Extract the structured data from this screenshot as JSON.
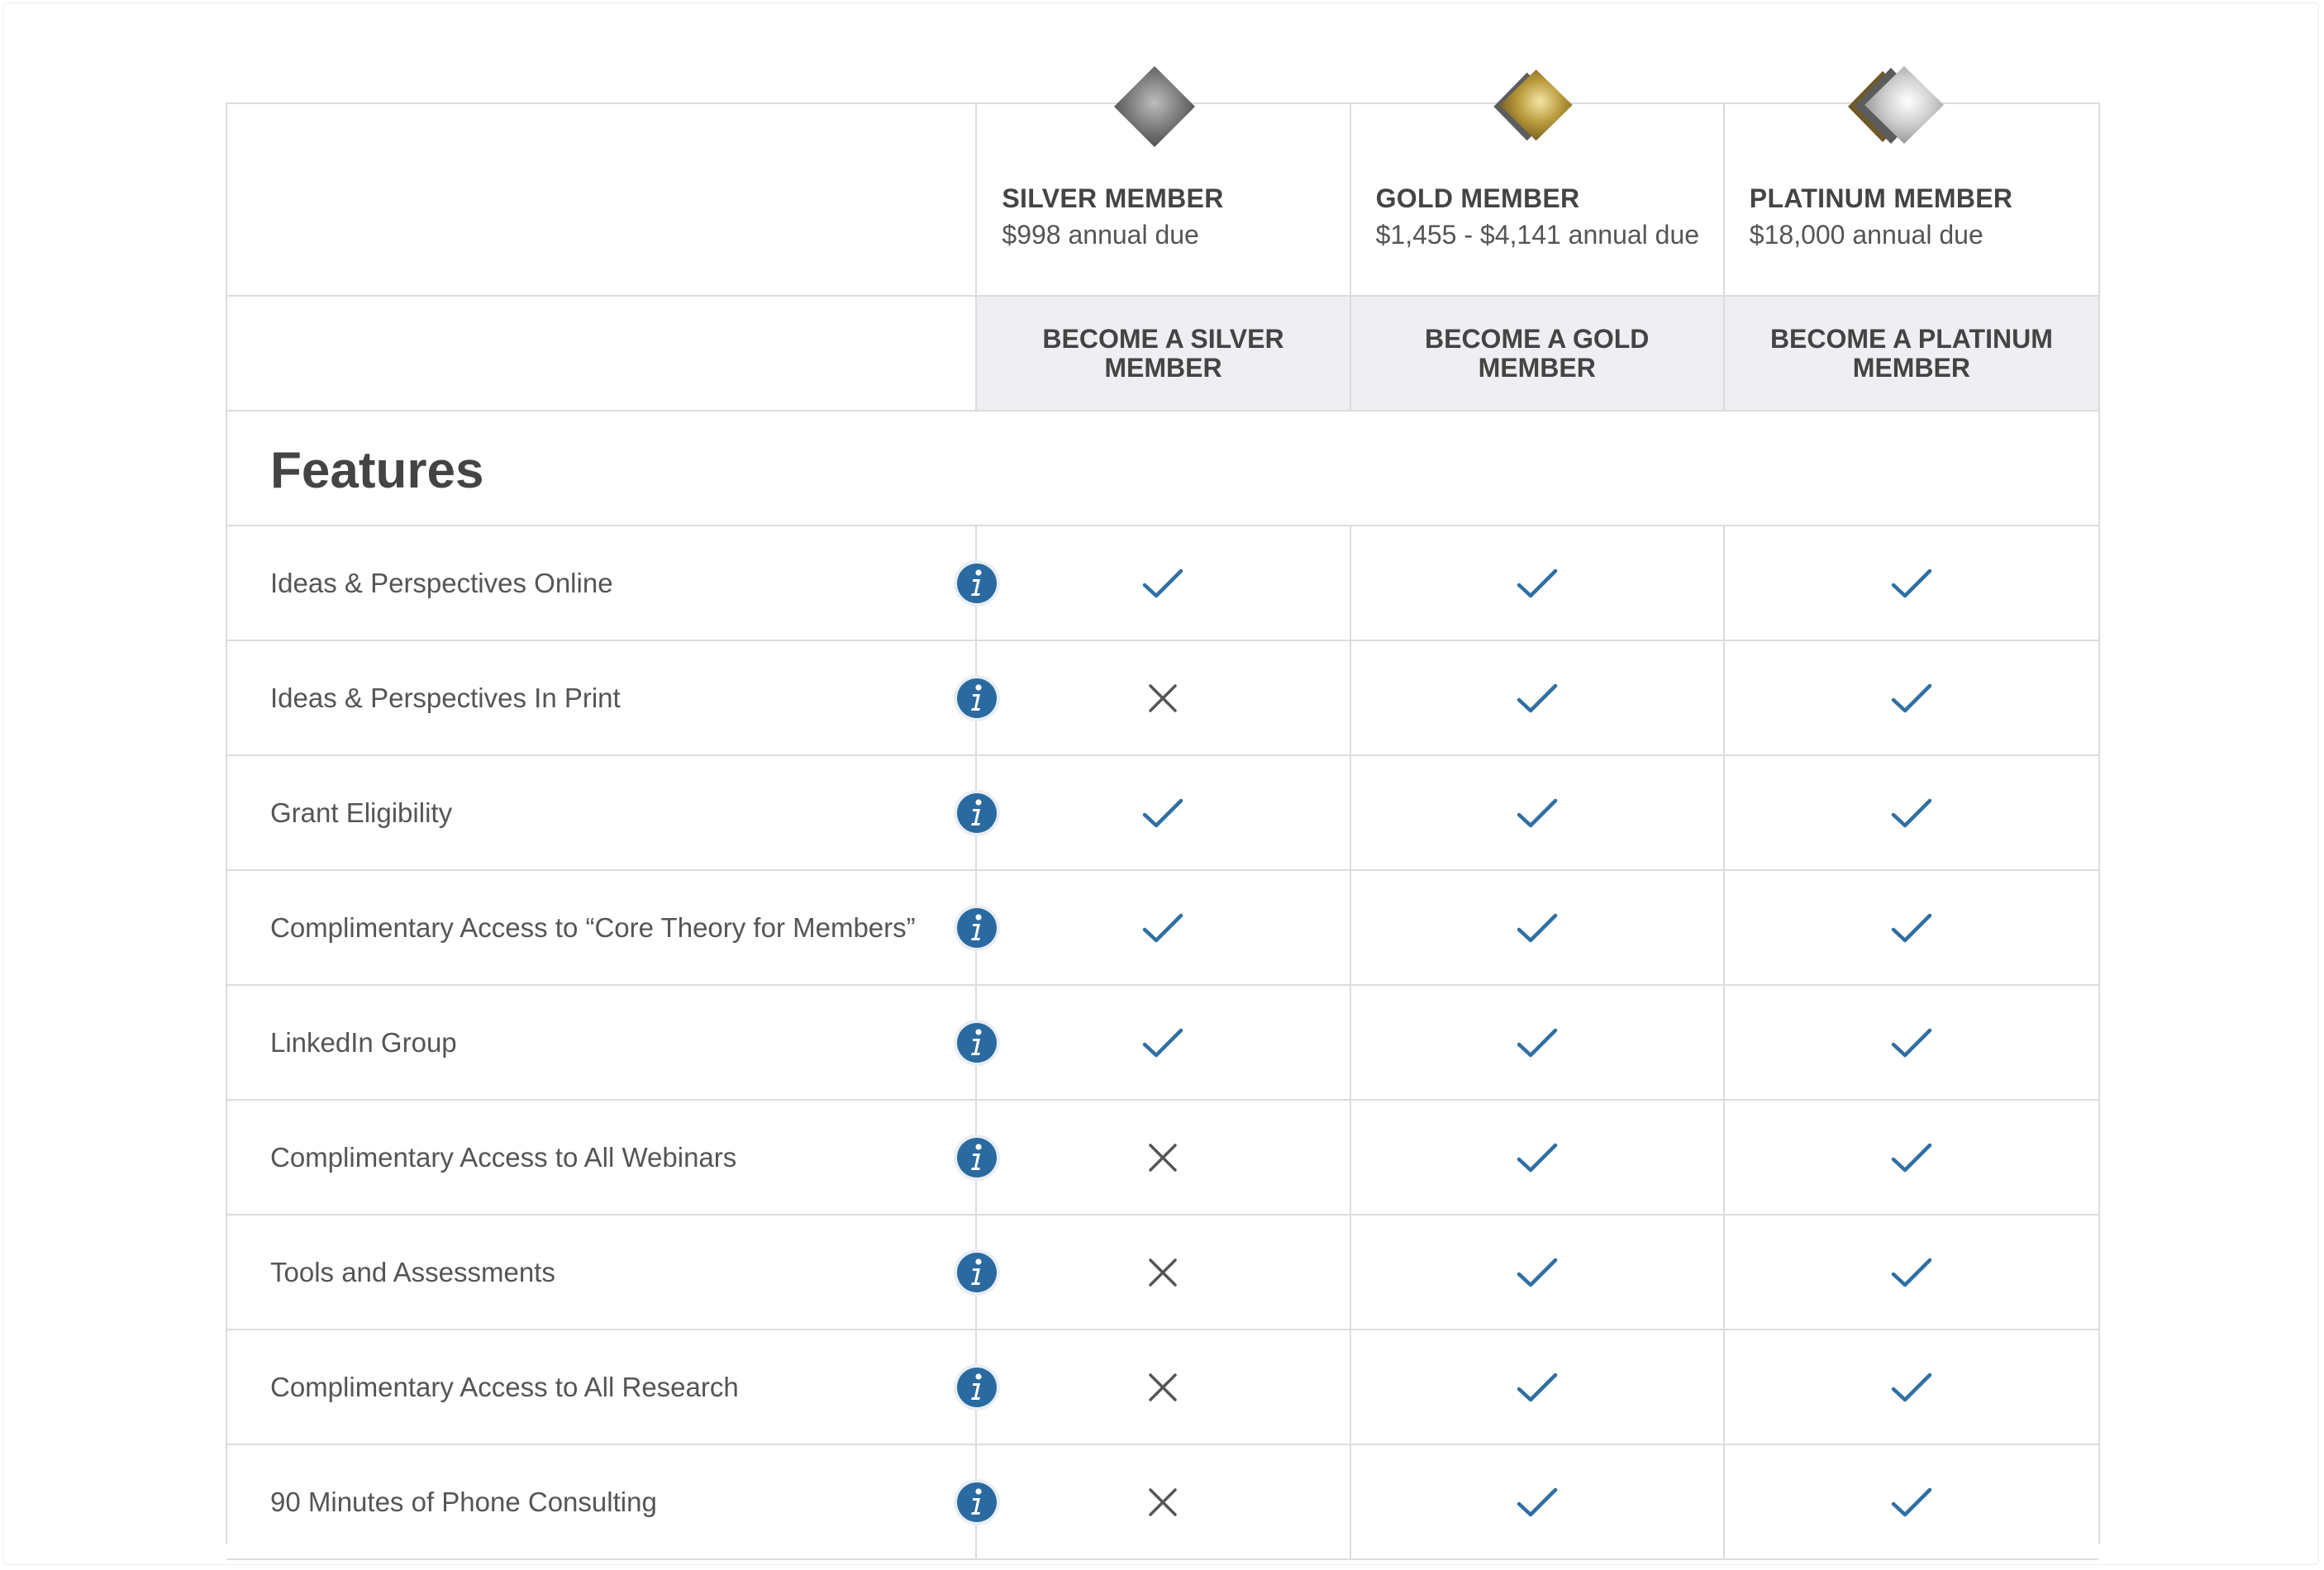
{
  "tiers": [
    {
      "name": "SILVER MEMBER",
      "price": "$998 annual due",
      "cta": "BECOME A SILVER MEMBER"
    },
    {
      "name": "GOLD MEMBER",
      "price": "$1,455 - $4,141 annual due",
      "cta": "BECOME A GOLD MEMBER"
    },
    {
      "name": "PLATINUM MEMBER",
      "price": "$18,000 annual due",
      "cta": "BECOME A PLATINUM MEMBER"
    }
  ],
  "features_heading": "Features",
  "features": [
    {
      "label": "Ideas & Perspectives Online",
      "included": [
        true,
        true,
        true
      ]
    },
    {
      "label": "Ideas & Perspectives In Print",
      "included": [
        false,
        true,
        true
      ]
    },
    {
      "label": "Grant Eligibility",
      "included": [
        true,
        true,
        true
      ]
    },
    {
      "label": "Complimentary Access to “Core Theory for Members”",
      "included": [
        true,
        true,
        true
      ]
    },
    {
      "label": "LinkedIn Group",
      "included": [
        true,
        true,
        true
      ]
    },
    {
      "label": "Complimentary Access to All Webinars",
      "included": [
        false,
        true,
        true
      ]
    },
    {
      "label": "Tools and Assessments",
      "included": [
        false,
        true,
        true
      ]
    },
    {
      "label": "Complimentary Access to All Research",
      "included": [
        false,
        true,
        true
      ]
    },
    {
      "label": "90 Minutes of Phone Consulting",
      "included": [
        false,
        true,
        true
      ]
    }
  ],
  "colors": {
    "check": "#2f6fa3",
    "cross": "#555555",
    "info": "#2a6aa0",
    "cta_background": "#eeeef3",
    "border": "#dcdcdc"
  },
  "icons": {
    "included": "checkmark-icon",
    "excluded": "x-icon",
    "info": "info-icon"
  }
}
